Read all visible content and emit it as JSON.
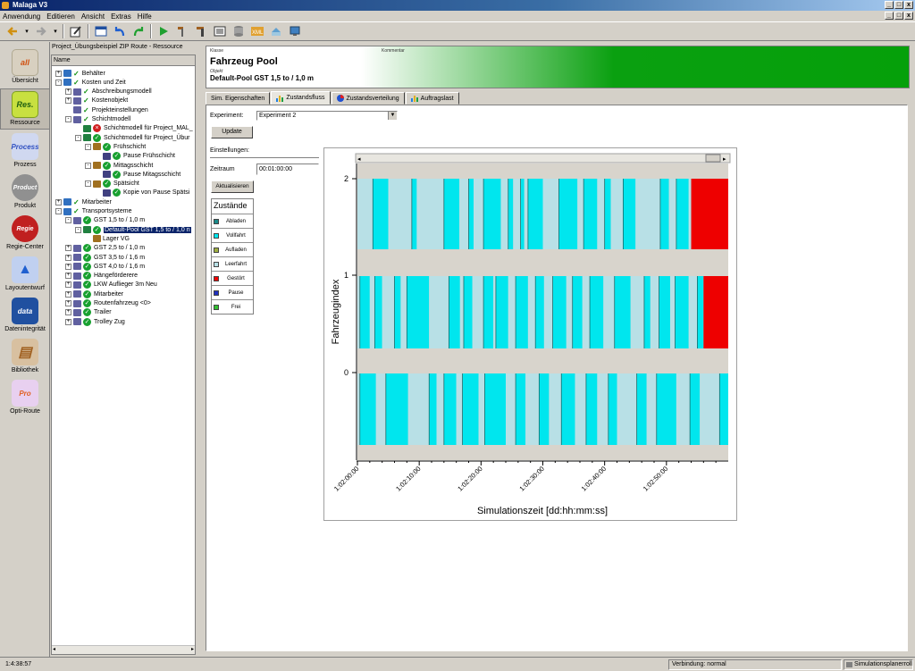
{
  "window": {
    "title": "Malaga V3"
  },
  "menu": [
    "Anwendung",
    "Editieren",
    "Ansicht",
    "Extras",
    "Hilfe"
  ],
  "window_buttons": [
    "_",
    "□",
    "x"
  ],
  "toolbar_icons": [
    "back-arrow-icon",
    "forward-arrow-icon",
    "dropdown-icon",
    "edit-icon",
    "window-icon",
    "undo-icon",
    "redo-icon",
    "run-icon",
    "tool-icon",
    "tool2-icon",
    "list-icon",
    "xml-icon",
    "database-icon",
    "export-icon",
    "monitor-icon"
  ],
  "sidebar": [
    {
      "label": "Übersicht",
      "icon": "overview-icon",
      "glyph": "all",
      "color": "#d05010"
    },
    {
      "label": "Ressource",
      "icon": "resource-icon",
      "glyph": "Res.",
      "color": "#78b020"
    },
    {
      "label": "Prozess",
      "icon": "process-icon",
      "glyph": "Process",
      "color": "#3050c0"
    },
    {
      "label": "Produkt",
      "icon": "product-icon",
      "glyph": "Product",
      "color": "#808080"
    },
    {
      "label": "Regie-Center",
      "icon": "regie-center-icon",
      "glyph": "Regie",
      "color": "#c02020"
    },
    {
      "label": "Layoutentwurf",
      "icon": "layout-icon",
      "glyph": "▲",
      "color": "#2060d0"
    },
    {
      "label": "Datenintegrität",
      "icon": "data-quality-icon",
      "glyph": "data",
      "color": "#2050a0"
    },
    {
      "label": "Bibliothek",
      "icon": "library-icon",
      "glyph": "▤",
      "color": "#a06020"
    },
    {
      "label": "Opti-Route",
      "icon": "opti-route-icon",
      "glyph": "Pro",
      "color": "#e06020"
    }
  ],
  "tree": {
    "title": "Project_Übungsbeispiel ZIP Route - Ressource",
    "column": "Name",
    "items": [
      {
        "label": "Behälter",
        "level": 0,
        "exp": "+",
        "mark": "check"
      },
      {
        "label": "Kosten und Zeit",
        "level": 0,
        "exp": "-",
        "mark": "check"
      },
      {
        "label": "Abschreibungsmodell",
        "level": 1,
        "exp": "+",
        "mark": "check"
      },
      {
        "label": "Kostenobjekt",
        "level": 1,
        "exp": "+",
        "mark": "check"
      },
      {
        "label": "Projekteinstellungen",
        "level": 1,
        "exp": "",
        "mark": "check"
      },
      {
        "label": "Schichtmodell",
        "level": 1,
        "exp": "-",
        "mark": "check"
      },
      {
        "label": "Schichtmodell für Project_MAL_",
        "level": 2,
        "exp": "",
        "mark": "cross"
      },
      {
        "label": "Schichtmodell für Project_Übur",
        "level": 2,
        "exp": "-",
        "mark": "circle"
      },
      {
        "label": "Frühschicht",
        "level": 3,
        "exp": "-",
        "mark": "circle"
      },
      {
        "label": "Pause Frühschicht",
        "level": 4,
        "exp": "",
        "mark": "circle"
      },
      {
        "label": "Mittagsschicht",
        "level": 3,
        "exp": "-",
        "mark": "circle"
      },
      {
        "label": "Pause Mitagsschicht",
        "level": 4,
        "exp": "",
        "mark": "circle"
      },
      {
        "label": "Spätsicht",
        "level": 3,
        "exp": "-",
        "mark": "circle"
      },
      {
        "label": "Kopie von Pause Spätsi",
        "level": 4,
        "exp": "",
        "mark": "circle"
      },
      {
        "label": "Mitarbeiter",
        "level": 0,
        "exp": "+",
        "mark": "check"
      },
      {
        "label": "Transportsysteme",
        "level": 0,
        "exp": "-",
        "mark": "check"
      },
      {
        "label": "GST 1,5 to / 1,0 m",
        "level": 1,
        "exp": "-",
        "mark": "circle"
      },
      {
        "label": "Default-Pool GST 1,5 to / 1,0 n",
        "level": 2,
        "exp": "-",
        "mark": "circle",
        "selected": true
      },
      {
        "label": "Lager VG",
        "level": 3,
        "exp": "",
        "mark": "none"
      },
      {
        "label": "GST 2,5 to / 1,0 m",
        "level": 1,
        "exp": "+",
        "mark": "circle"
      },
      {
        "label": "GST 3,5 to / 1,6 m",
        "level": 1,
        "exp": "+",
        "mark": "circle"
      },
      {
        "label": "GST 4,0 to / 1,6 m",
        "level": 1,
        "exp": "+",
        "mark": "circle"
      },
      {
        "label": "Hängeförderere",
        "level": 1,
        "exp": "+",
        "mark": "circle"
      },
      {
        "label": "LKW Auflieger 3m Neu",
        "level": 1,
        "exp": "+",
        "mark": "circle"
      },
      {
        "label": "Mitarbeiter",
        "level": 1,
        "exp": "+",
        "mark": "circle"
      },
      {
        "label": "Routenfahrzeug <0>",
        "level": 1,
        "exp": "+",
        "mark": "circle"
      },
      {
        "label": "Trailer",
        "level": 1,
        "exp": "+",
        "mark": "circle"
      },
      {
        "label": "Trolley Zug",
        "level": 1,
        "exp": "+",
        "mark": "circle"
      }
    ]
  },
  "banner": {
    "klasse": "Klasse",
    "kommentar": "Kommentar",
    "title": "Fahrzeug Pool",
    "objekt": "Objekt",
    "object_name": "Default-Pool GST 1,5 to / 1,0 m"
  },
  "tabs": [
    {
      "label": "Sim. Eigenschaften",
      "active": false
    },
    {
      "label": "Zustandsfluss",
      "active": true
    },
    {
      "label": "Zustandsverteilung",
      "active": false
    },
    {
      "label": "Auftragslast",
      "active": false
    }
  ],
  "form": {
    "experiment_label": "Experiment:",
    "experiment_value": "Experiment 2",
    "update_button": "Update",
    "settings_label": "Einstellungen:",
    "zeitraum_label": "Zeitraum",
    "zeitraum_value": "00:01:00:00",
    "aktualisieren_button": "Aktualisieren"
  },
  "legend": {
    "title": "Zustände",
    "items": [
      {
        "label": "Abladen",
        "color": "#1a8a8a"
      },
      {
        "label": "Vollfahrt",
        "color": "#00e6ee"
      },
      {
        "label": "Aufladen",
        "color": "#a0b040"
      },
      {
        "label": "Leerfahrt",
        "color": "#b8e0e6"
      },
      {
        "label": "Gestört",
        "color": "#ee0000"
      },
      {
        "label": "Pause",
        "color": "#2030c0"
      },
      {
        "label": "Frei",
        "color": "#30c030"
      }
    ]
  },
  "chart_data": {
    "type": "gantt",
    "xlabel": "Simulationszeit [dd:hh:mm:ss]",
    "ylabel": "Fahrzeugindex",
    "xlim": [
      "1:02:00:00",
      "1:03:00:00"
    ],
    "x_ticks": [
      "1:02:00:00",
      "1:02:10:00",
      "1:02:20:00",
      "1:02:30:00",
      "1:02:40:00",
      "1:02:50:00"
    ],
    "y_ticks": [
      "0",
      "1",
      "2"
    ],
    "series": [
      {
        "name": "2",
        "segments": [
          [
            "Leerfahrt",
            0.0,
            2.5
          ],
          [
            "Vollfahrt",
            2.5,
            5.0
          ],
          [
            "Leerfahrt",
            5.0,
            8.8
          ],
          [
            "Vollfahrt",
            8.8,
            9.6
          ],
          [
            "Leerfahrt",
            9.6,
            14.0
          ],
          [
            "Vollfahrt",
            14.0,
            16.5
          ],
          [
            "Leerfahrt",
            16.5,
            18.0
          ],
          [
            "Vollfahrt",
            18.0,
            18.8
          ],
          [
            "Leerfahrt",
            18.8,
            20.4
          ],
          [
            "Vollfahrt",
            20.4,
            23.2
          ],
          [
            "Leerfahrt",
            23.2,
            24.4
          ],
          [
            "Vollfahrt",
            24.4,
            25.2
          ],
          [
            "Leerfahrt",
            25.2,
            26.4
          ],
          [
            "Vollfahrt",
            26.4,
            27.0
          ],
          [
            "Leerfahrt",
            27.0,
            27.6
          ],
          [
            "Vollfahrt",
            27.6,
            30.0
          ],
          [
            "Leerfahrt",
            30.0,
            32.6
          ],
          [
            "Vollfahrt",
            32.6,
            35.6
          ],
          [
            "Leerfahrt",
            35.6,
            36.6
          ],
          [
            "Vollfahrt",
            36.6,
            38.8
          ],
          [
            "Leerfahrt",
            38.8,
            40.0
          ],
          [
            "Vollfahrt",
            40.0,
            41.0
          ],
          [
            "Leerfahrt",
            41.0,
            43.0
          ],
          [
            "Vollfahrt",
            43.0,
            45.0
          ],
          [
            "Leerfahrt",
            45.0,
            49.0
          ],
          [
            "Vollfahrt",
            49.0,
            50.4
          ],
          [
            "Leerfahrt",
            50.4,
            51.6
          ],
          [
            "Vollfahrt",
            51.6,
            53.6
          ],
          [
            "Leerfahrt",
            53.6,
            54.0
          ],
          [
            "Gestört",
            54.0,
            60.0
          ]
        ]
      },
      {
        "name": "1",
        "segments": [
          [
            "Leerfahrt",
            0.0,
            0.4
          ],
          [
            "Vollfahrt",
            0.4,
            2.0
          ],
          [
            "Leerfahrt",
            2.0,
            2.8
          ],
          [
            "Vollfahrt",
            2.8,
            4.0
          ],
          [
            "Leerfahrt",
            4.0,
            6.0
          ],
          [
            "Vollfahrt",
            6.0,
            7.0
          ],
          [
            "Leerfahrt",
            7.0,
            8.0
          ],
          [
            "Vollfahrt",
            8.0,
            11.6
          ],
          [
            "Leerfahrt",
            11.6,
            14.8
          ],
          [
            "Vollfahrt",
            14.8,
            16.6
          ],
          [
            "Leerfahrt",
            16.6,
            17.2
          ],
          [
            "Vollfahrt",
            17.2,
            18.6
          ],
          [
            "Leerfahrt",
            18.6,
            20.4
          ],
          [
            "Vollfahrt",
            20.4,
            22.0
          ],
          [
            "Leerfahrt",
            22.0,
            22.4
          ],
          [
            "Vollfahrt",
            22.4,
            24.4
          ],
          [
            "Leerfahrt",
            24.4,
            25.6
          ],
          [
            "Vollfahrt",
            25.6,
            27.6
          ],
          [
            "Leerfahrt",
            27.6,
            28.8
          ],
          [
            "Vollfahrt",
            28.8,
            30.2
          ],
          [
            "Leerfahrt",
            30.2,
            31.6
          ],
          [
            "Vollfahrt",
            31.6,
            33.8
          ],
          [
            "Leerfahrt",
            33.8,
            34.8
          ],
          [
            "Vollfahrt",
            34.8,
            36.4
          ],
          [
            "Leerfahrt",
            36.4,
            37.6
          ],
          [
            "Vollfahrt",
            37.6,
            39.8
          ],
          [
            "Leerfahrt",
            39.8,
            41.6
          ],
          [
            "Vollfahrt",
            41.6,
            44.2
          ],
          [
            "Leerfahrt",
            44.2,
            46.4
          ],
          [
            "Vollfahrt",
            46.4,
            47.4
          ],
          [
            "Leerfahrt",
            47.4,
            48.8
          ],
          [
            "Vollfahrt",
            48.8,
            50.6
          ],
          [
            "Leerfahrt",
            50.6,
            51.4
          ],
          [
            "Vollfahrt",
            51.4,
            53.6
          ],
          [
            "Leerfahrt",
            53.6,
            55.0
          ],
          [
            "Vollfahrt",
            55.0,
            56.0
          ],
          [
            "Gestört",
            56.0,
            60.0
          ]
        ]
      },
      {
        "name": "0",
        "segments": [
          [
            "Leerfahrt",
            0.0,
            0.4
          ],
          [
            "Vollfahrt",
            0.4,
            3.0
          ],
          [
            "Leerfahrt",
            3.0,
            4.6
          ],
          [
            "Vollfahrt",
            4.6,
            8.2
          ],
          [
            "Leerfahrt",
            8.2,
            11.6
          ],
          [
            "Vollfahrt",
            11.6,
            12.8
          ],
          [
            "Leerfahrt",
            12.8,
            14.0
          ],
          [
            "Vollfahrt",
            14.0,
            16.0
          ],
          [
            "Leerfahrt",
            16.0,
            17.0
          ],
          [
            "Vollfahrt",
            17.0,
            19.6
          ],
          [
            "Leerfahrt",
            19.6,
            20.6
          ],
          [
            "Vollfahrt",
            20.6,
            24.0
          ],
          [
            "Leerfahrt",
            24.0,
            25.6
          ],
          [
            "Vollfahrt",
            25.6,
            27.2
          ],
          [
            "Leerfahrt",
            27.2,
            29.4
          ],
          [
            "Vollfahrt",
            29.4,
            31.0
          ],
          [
            "Leerfahrt",
            31.0,
            33.0
          ],
          [
            "Vollfahrt",
            33.0,
            35.2
          ],
          [
            "Leerfahrt",
            35.2,
            37.0
          ],
          [
            "Vollfahrt",
            37.0,
            38.8
          ],
          [
            "Leerfahrt",
            38.8,
            40.6
          ],
          [
            "Vollfahrt",
            40.6,
            42.0
          ],
          [
            "Leerfahrt",
            42.0,
            45.2
          ],
          [
            "Vollfahrt",
            45.2,
            46.8
          ],
          [
            "Leerfahrt",
            46.8,
            48.4
          ],
          [
            "Vollfahrt",
            48.4,
            51.6
          ],
          [
            "Leerfahrt",
            51.6,
            53.8
          ],
          [
            "Vollfahrt",
            53.8,
            55.4
          ],
          [
            "Leerfahrt",
            55.4,
            58.6
          ],
          [
            "Vollfahrt",
            58.6,
            60.0
          ]
        ]
      }
    ]
  },
  "status": {
    "time": "1:4:38:57",
    "connection": "Verbindung: normal",
    "role": "Simulationsplanerrolle"
  }
}
